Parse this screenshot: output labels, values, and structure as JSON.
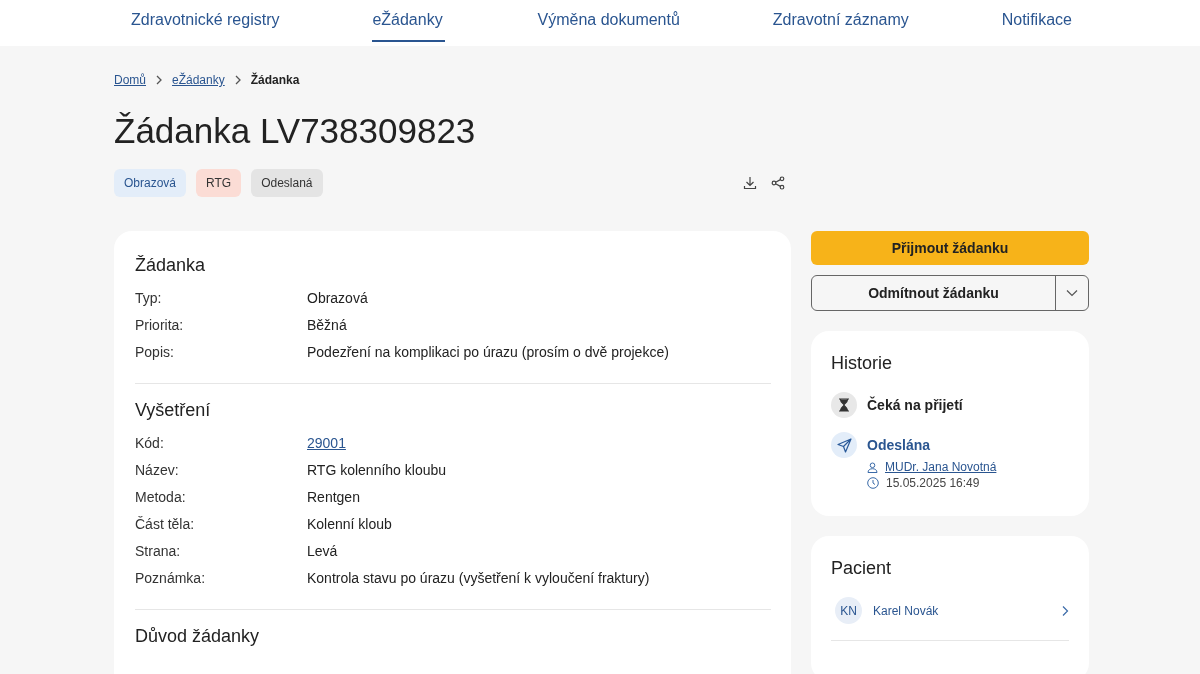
{
  "nav": [
    {
      "label": "Zdravotnické registry",
      "selected": false
    },
    {
      "label": "eŽádanky",
      "selected": true
    },
    {
      "label": "Výměna dokumentů",
      "selected": false
    },
    {
      "label": "Zdravotní záznamy",
      "selected": false
    },
    {
      "label": "Notifikace",
      "selected": false
    }
  ],
  "breadcrumb": [
    {
      "label": "Domů",
      "kind": "link"
    },
    {
      "label": "eŽádanky",
      "kind": "link"
    },
    {
      "label": "Žádanka",
      "kind": "current"
    }
  ],
  "title": "Žádanka LV738309823",
  "tags": [
    {
      "label": "Obrazová",
      "color": "#e3edf9"
    },
    {
      "label": "RTG",
      "color": "#fbdcd5"
    },
    {
      "label": "Odeslaná",
      "color": "#e4e4e4"
    }
  ],
  "sections": [
    {
      "title": "Žádanka",
      "fields": [
        {
          "label": "Typ:",
          "value": "Obrazová",
          "kind": "text"
        },
        {
          "label": "Priorita:",
          "value": "Běžná",
          "kind": "text"
        },
        {
          "label": "Popis:",
          "value": "Podezření na komplikaci po úrazu (prosím o dvě projekce)",
          "kind": "text"
        }
      ]
    },
    {
      "title": "Vyšetření",
      "fields": [
        {
          "label": "Kód:",
          "value": "29001",
          "kind": "link"
        },
        {
          "label": "Název:",
          "value": "RTG kolenního kloubu",
          "kind": "text"
        },
        {
          "label": "Metoda:",
          "value": "Rentgen",
          "kind": "text"
        },
        {
          "label": "Část těla:",
          "value": "Kolenní kloub",
          "kind": "text"
        },
        {
          "label": "Strana:",
          "value": "Levá",
          "kind": "text"
        },
        {
          "label": "Poznámka:",
          "value": "Kontrola stavu po úrazu (vyšetření k vyloučení fraktury)",
          "kind": "text"
        }
      ]
    },
    {
      "title": "Důvod žádanky"
    }
  ],
  "actions": {
    "accept": "Přijmout žádanku",
    "reject": "Odmítnout žádanku"
  },
  "history": {
    "title": "Historie",
    "items": [
      {
        "label": "Čeká na přijetí",
        "kind": "pending"
      },
      {
        "label": "Odeslána",
        "kind": "sent",
        "author": "MUDr. Jana Novotná",
        "time": "15.05.2025 16:49"
      }
    ]
  },
  "patient": {
    "title": "Pacient",
    "initials": "KN",
    "name": "Karel Novák"
  }
}
